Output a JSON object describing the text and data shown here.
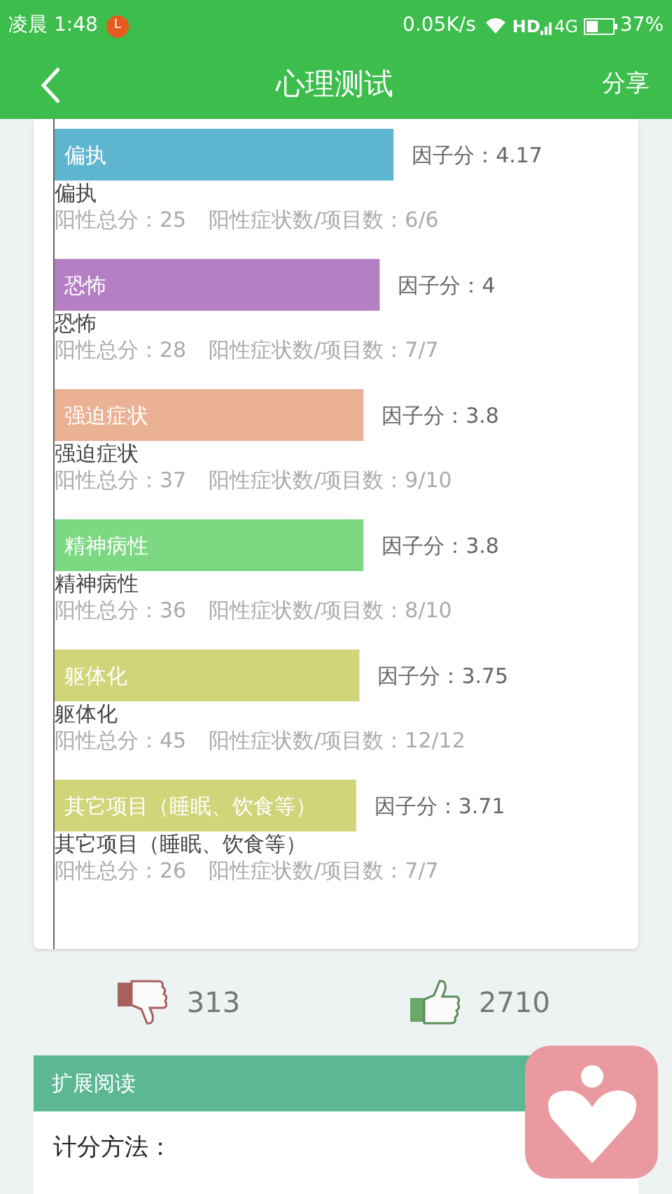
{
  "status_bar": {
    "time": "凌晨 1:48",
    "badge": "L",
    "speed": "0.05K/s",
    "network": "HD",
    "network_type": "4G",
    "battery": "37%"
  },
  "header": {
    "title": "心理测试",
    "action": "分享"
  },
  "chart_data": {
    "type": "bar",
    "orientation": "horizontal",
    "categories": [
      "偏执",
      "恐怖",
      "强迫症状",
      "精神病性",
      "躯体化",
      "其它项目（睡眠、饮食等）"
    ],
    "values": [
      4.17,
      4,
      3.8,
      3.8,
      3.75,
      3.71
    ],
    "value_labels": [
      "因子分：4.17",
      "因子分：4",
      "因子分：3.8",
      "因子分：3.8",
      "因子分：3.75",
      "因子分：3.71"
    ]
  },
  "factors": [
    {
      "color": "#5fb6d0",
      "label": "偏执",
      "total": "阳性总分：25",
      "count": "阳性症状数/项目数：6/6"
    },
    {
      "color": "#b47fc3",
      "label": "恐怖",
      "total": "阳性总分：28",
      "count": "阳性症状数/项目数：7/7"
    },
    {
      "color": "#ebb194",
      "label": "强迫症状",
      "total": "阳性总分：37",
      "count": "阳性症状数/项目数：9/10"
    },
    {
      "color": "#7dd882",
      "label": "精神病性",
      "total": "阳性总分：36",
      "count": "阳性症状数/项目数：8/10"
    },
    {
      "color": "#d0d57a",
      "label": "躯体化",
      "total": "阳性总分：45",
      "count": "阳性症状数/项目数：12/12"
    },
    {
      "color": "#d0d57a",
      "label": "其它项目（睡眠、饮食等）",
      "total": "阳性总分：26",
      "count": "阳性症状数/项目数：7/7"
    }
  ],
  "votes": {
    "dislikes": "313",
    "likes": "2710"
  },
  "extended_reading": {
    "title": "扩展阅读",
    "body": "计分方法："
  }
}
